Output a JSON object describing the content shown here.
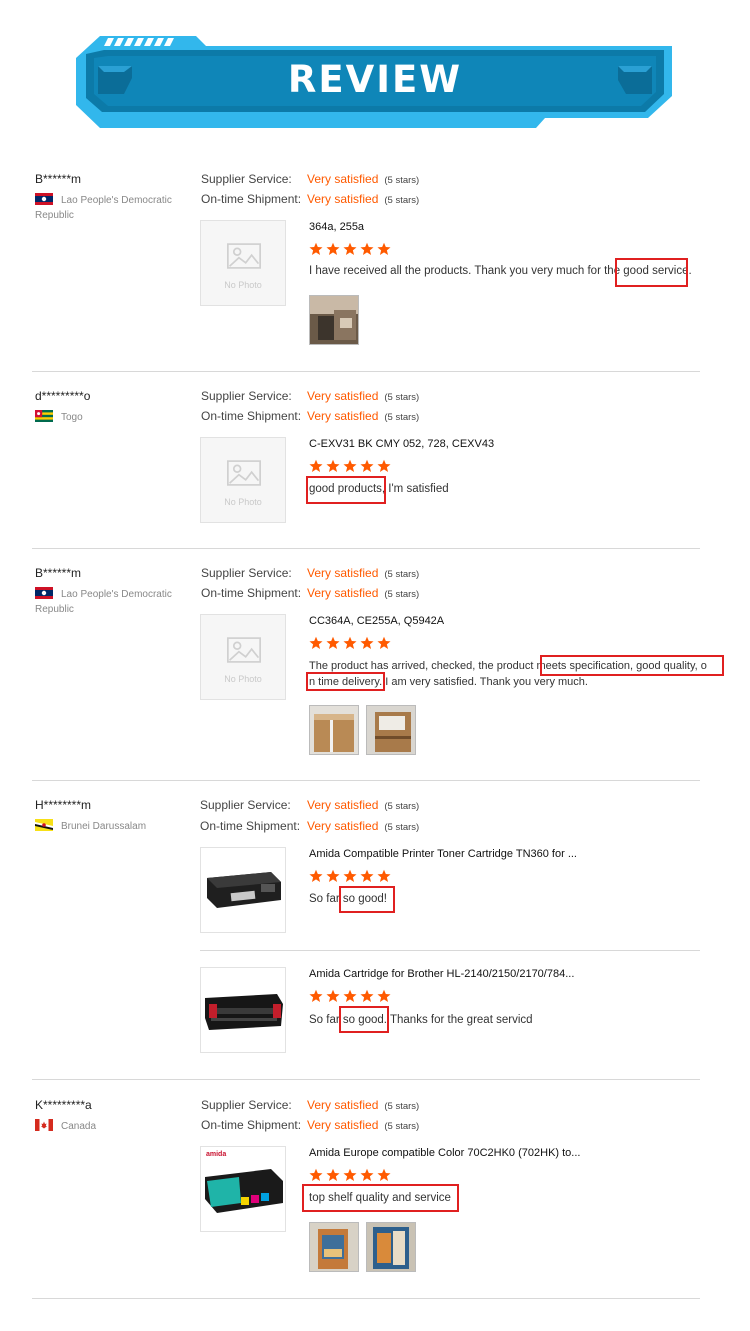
{
  "banner": {
    "title": "REVIEW"
  },
  "labels": {
    "supplier_service": "Supplier Service:",
    "ontime_shipment": "On-time Shipment:",
    "rating_value": "Very satisfied",
    "rating_stars": "(5 stars)",
    "no_photo": "No Photo"
  },
  "colors": {
    "accent": "#ff5a00",
    "highlight": "#e02020",
    "banner": "#0a7fb0"
  },
  "reviews": [
    {
      "user": "B******m",
      "country": "Lao People's Democratic Republic",
      "flag": "laos-flag-icon",
      "items": [
        {
          "product": "364a, 255a",
          "stars": 5,
          "comment": "I have received all the products. Thank you very much for the good service.",
          "highlight": "good service."
        }
      ],
      "photos": 1
    },
    {
      "user": "d*********o",
      "country": "Togo",
      "flag": "togo-flag-icon",
      "items": [
        {
          "product": "C-EXV31 BK CMY 052, 728, CEXV43",
          "stars": 5,
          "comment": "good products, I'm satisfied",
          "highlight": "good products"
        }
      ],
      "photos": 0
    },
    {
      "user": "B******m",
      "country": "Lao People's Democratic Republic",
      "flag": "laos-flag-icon",
      "items": [
        {
          "product": "CC364A, CE255A, Q5942A",
          "stars": 5,
          "comment_line1": "The product has arrived, checked, the product meets specification, good quality, o",
          "comment_line2": "n time delivery. I am very satisfied. Thank you very much.",
          "highlight": "meets specification, good quality, on time delivery"
        }
      ],
      "photos": 2
    },
    {
      "user": "H********m",
      "country": "Brunei Darussalam",
      "flag": "brunei-flag-icon",
      "items": [
        {
          "product": "Amida Compatible Printer Toner Cartridge TN360 for ...",
          "stars": 5,
          "comment": "So far so good!",
          "highlight": "so good!"
        },
        {
          "product": "Amida Cartridge for Brother HL-2140/2150/2170/784...",
          "stars": 5,
          "comment": "So far so good. Thanks for the great servicd",
          "highlight": "so good"
        }
      ],
      "photos": 0
    },
    {
      "user": "K*********a",
      "country": "Canada",
      "flag": "canada-flag-icon",
      "items": [
        {
          "product": "Amida Europe compatible Color 70C2HK0 (702HK) to...",
          "stars": 5,
          "comment": "top shelf quality and service",
          "highlight": "top shelf quality and service",
          "brand": "amida"
        }
      ],
      "photos": 2
    }
  ]
}
